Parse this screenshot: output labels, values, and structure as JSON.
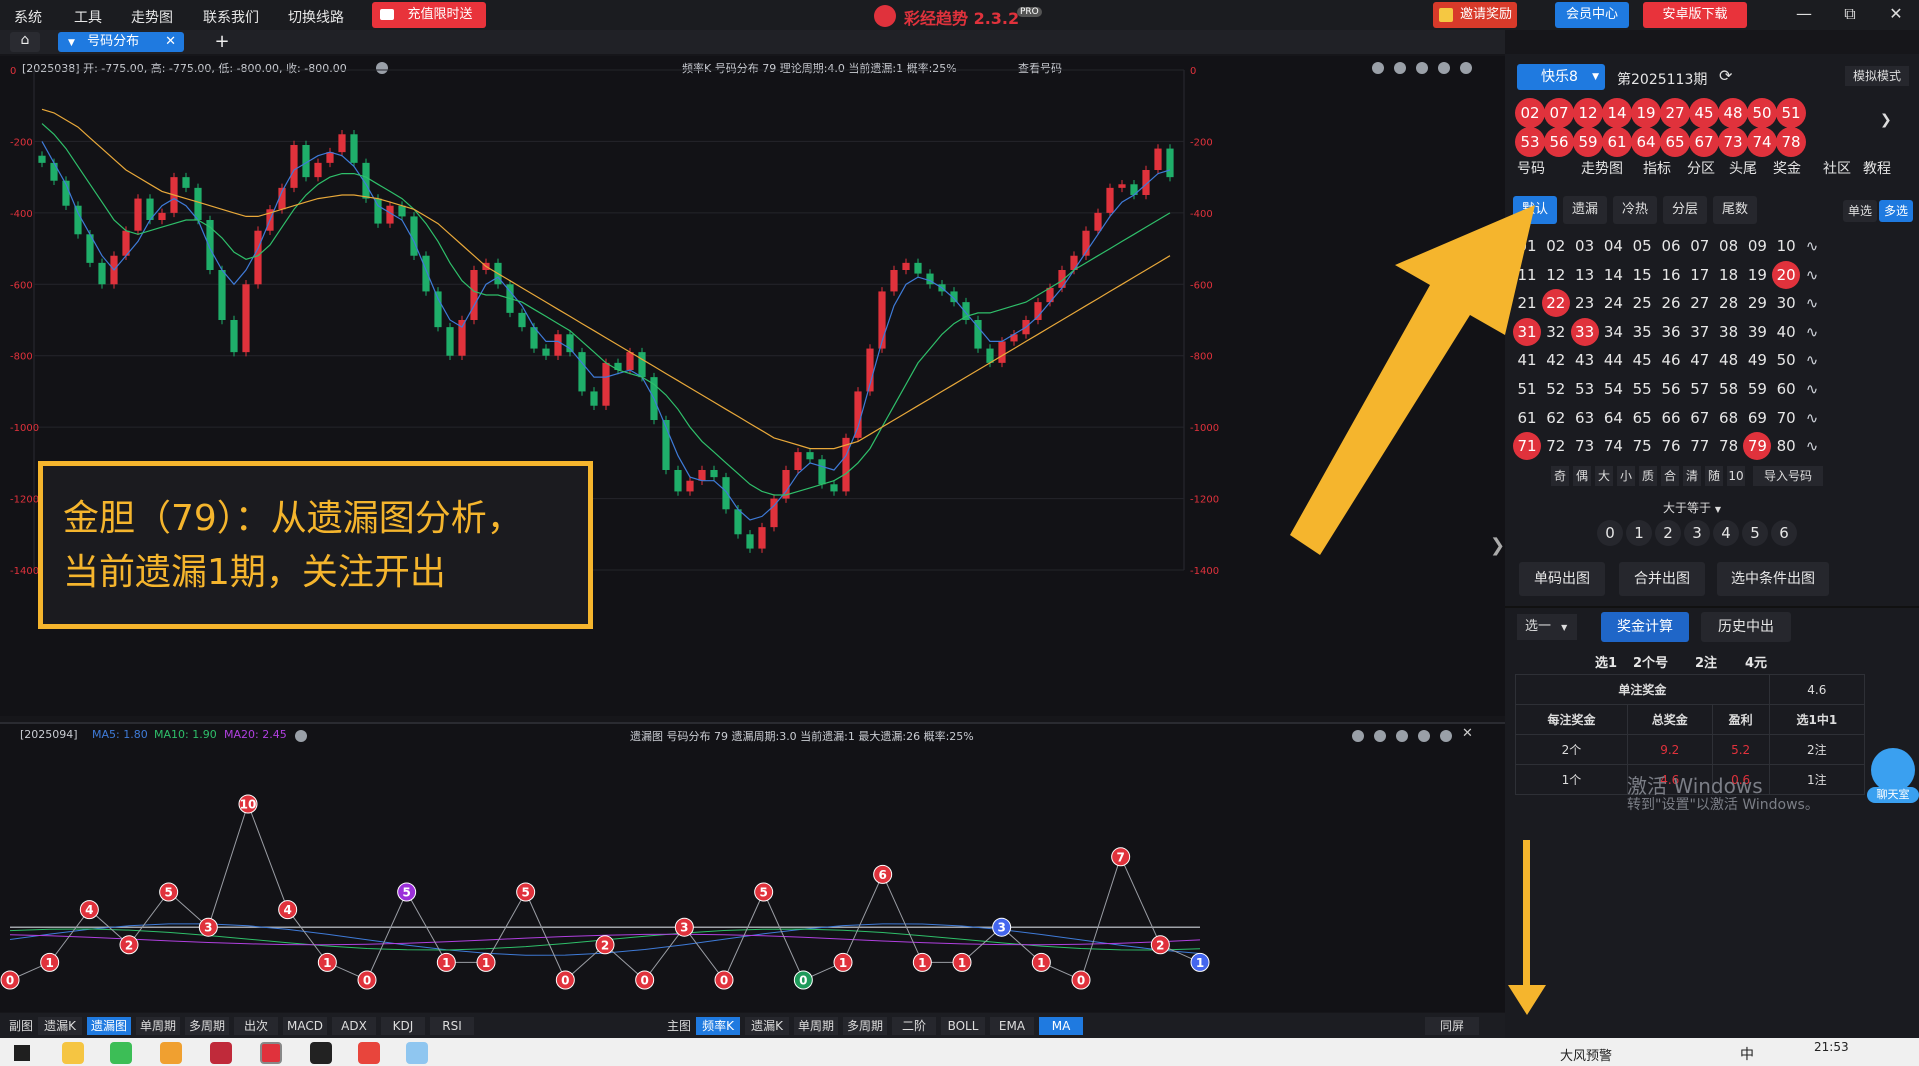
{
  "menu": [
    "系统",
    "工具",
    "走势图",
    "联系我们",
    "切换线路"
  ],
  "promo_label": "充值限时送",
  "app_title": "彩经趋势 2.3.2",
  "app_badge": "PRO",
  "invite_label": "邀请奖励",
  "member_label": "会员中心",
  "android_label": "安卓版下载",
  "tab": {
    "label": "号码分布",
    "add": "+"
  },
  "main_chart": {
    "info_left": "[2025038]   开: -775.00, 高: -775.00, 低: -800.00, 收: -800.00",
    "info_mid": "频率K  号码分布  79    理论周期:4.0  当前遗漏:1  概率:25%",
    "info_link": "查看号码",
    "y_ticks": [
      "0",
      "-200",
      "-400",
      "-600",
      "-800",
      "-1000",
      "-1200",
      "-1400"
    ],
    "ma_colors": [
      "#3f7bd8",
      "#2fbf6a",
      "#e8a83a",
      "#d8d8d8"
    ]
  },
  "chart_data": [
    {
      "type": "candlestick",
      "title": "频率K 号码分布 79",
      "ylim": [
        -1400,
        0
      ],
      "series": [
        {
          "name": "K",
          "values": [
            -260,
            -310,
            -380,
            -460,
            -540,
            -600,
            -520,
            -450,
            -360,
            -420,
            -400,
            -300,
            -330,
            -420,
            -560,
            -700,
            -790,
            -600,
            -450,
            -390,
            -330,
            -210,
            -300,
            -260,
            -230,
            -180,
            -260,
            -360,
            -430,
            -380,
            -410,
            -520,
            -620,
            -720,
            -800,
            -700,
            -560,
            -540,
            -600,
            -680,
            -720,
            -780,
            -800,
            -740,
            -790,
            -900,
            -940,
            -820,
            -840,
            -790,
            -860,
            -980,
            -1120,
            -1180,
            -1150,
            -1120,
            -1140,
            -1230,
            -1300,
            -1340,
            -1280,
            -1200,
            -1120,
            -1070,
            -1090,
            -1160,
            -1180,
            -1030,
            -900,
            -780,
            -620,
            -560,
            -540,
            -570,
            -600,
            -620,
            -650,
            -700,
            -780,
            -820,
            -760,
            -740,
            -700,
            -650,
            -610,
            -560,
            -520,
            -450,
            -400,
            -330,
            -320,
            -350,
            -280,
            -220,
            -300
          ]
        },
        {
          "name": "MA5",
          "values": [
            -200,
            -260,
            -320,
            -400,
            -460,
            -520,
            -560,
            -520,
            -480,
            -420,
            -380,
            -360,
            -380,
            -420,
            -500,
            -560,
            -600,
            -560,
            -500,
            -420,
            -340,
            -280,
            -260,
            -240,
            -230,
            -240,
            -270,
            -320,
            -380,
            -400,
            -420,
            -480,
            -560,
            -640,
            -700,
            -720,
            -660,
            -600,
            -580,
            -620,
            -660,
            -720,
            -760,
            -760,
            -780,
            -820,
            -860,
            -860,
            -850,
            -840,
            -860,
            -920,
            -1000,
            -1080,
            -1140,
            -1150,
            -1150,
            -1180,
            -1230,
            -1260,
            -1250,
            -1220,
            -1180,
            -1130,
            -1100,
            -1110,
            -1120,
            -1080,
            -1000,
            -880,
            -760,
            -660,
            -600,
            -580,
            -590,
            -610,
            -640,
            -680,
            -720,
            -760,
            -760,
            -740,
            -720,
            -690,
            -650,
            -610,
            -560,
            -510,
            -460,
            -410,
            -370,
            -350,
            -320,
            -290,
            -280
          ]
        },
        {
          "name": "MA10",
          "values": [
            -150,
            -180,
            -220,
            -270,
            -320,
            -370,
            -420,
            -450,
            -460,
            -450,
            -440,
            -430,
            -420,
            -420,
            -440,
            -470,
            -510,
            -530,
            -520,
            -490,
            -440,
            -390,
            -350,
            -320,
            -300,
            -290,
            -290,
            -300,
            -320,
            -340,
            -360,
            -390,
            -430,
            -480,
            -540,
            -590,
            -620,
            -630,
            -630,
            -640,
            -650,
            -670,
            -690,
            -710,
            -730,
            -760,
            -790,
            -820,
            -840,
            -850,
            -860,
            -880,
            -910,
            -950,
            -1000,
            -1040,
            -1070,
            -1100,
            -1130,
            -1160,
            -1180,
            -1190,
            -1190,
            -1180,
            -1170,
            -1160,
            -1150,
            -1130,
            -1100,
            -1060,
            -1000,
            -940,
            -880,
            -820,
            -780,
            -740,
            -710,
            -690,
            -680,
            -680,
            -670,
            -660,
            -650,
            -630,
            -610,
            -590,
            -560,
            -540,
            -520,
            -500,
            -480,
            -460,
            -440,
            -420,
            -400
          ]
        },
        {
          "name": "MA20",
          "values": [
            -110,
            -120,
            -140,
            -160,
            -190,
            -220,
            -250,
            -280,
            -300,
            -320,
            -340,
            -350,
            -360,
            -370,
            -380,
            -390,
            -400,
            -410,
            -410,
            -400,
            -390,
            -380,
            -370,
            -360,
            -355,
            -350,
            -350,
            -355,
            -360,
            -370,
            -380,
            -390,
            -410,
            -430,
            -460,
            -490,
            -520,
            -550,
            -570,
            -590,
            -610,
            -630,
            -650,
            -670,
            -690,
            -710,
            -730,
            -750,
            -770,
            -790,
            -810,
            -830,
            -850,
            -870,
            -890,
            -910,
            -930,
            -950,
            -970,
            -990,
            -1010,
            -1030,
            -1040,
            -1050,
            -1060,
            -1060,
            -1060,
            -1050,
            -1040,
            -1020,
            -1000,
            -980,
            -960,
            -940,
            -920,
            -900,
            -880,
            -860,
            -840,
            -820,
            -800,
            -780,
            -760,
            -740,
            -720,
            -700,
            -680,
            -660,
            -640,
            -620,
            -600,
            -580,
            -560,
            -540,
            -520
          ]
        }
      ]
    },
    {
      "type": "line",
      "title": "遗漏图 号码分布 79",
      "ylim": [
        0,
        10
      ],
      "series": [
        {
          "name": "遗漏",
          "values": [
            0,
            1,
            4,
            2,
            5,
            3,
            10,
            4,
            1,
            0,
            5,
            1,
            1,
            5,
            0,
            2,
            0,
            3,
            0,
            5,
            0,
            1,
            6,
            1,
            1,
            3,
            1,
            0,
            7,
            2,
            1
          ]
        }
      ]
    }
  ],
  "annotation": {
    "line1": "金胆（79）：从遗漏图分析，",
    "line2": "当前遗漏1期，关注开出"
  },
  "sub_chart": {
    "info_left": "[2025094]",
    "ma5": "MA5: 1.80",
    "ma10": "MA10: 1.90",
    "ma20": "MA20: 2.45",
    "info_mid": "遗漏图  号码分布  79     遗漏周期:3.0  当前遗漏:1  最大遗漏:26  概率:25%"
  },
  "right": {
    "lottery": "快乐8",
    "period": "第2025113期",
    "sim_mode": "模拟模式",
    "drawn": [
      "02",
      "07",
      "12",
      "14",
      "19",
      "27",
      "45",
      "48",
      "50",
      "51",
      "53",
      "56",
      "59",
      "61",
      "64",
      "65",
      "67",
      "73",
      "74",
      "78"
    ],
    "tabs": [
      "号码",
      "走势图",
      "指标",
      "分区",
      "头尾",
      "奖金",
      "社区",
      "教程"
    ],
    "filters": [
      "默认",
      "遗漏",
      "冷热",
      "分层",
      "尾数"
    ],
    "single": "单选",
    "multi": "多选",
    "grid": [
      "01",
      "02",
      "03",
      "04",
      "05",
      "06",
      "07",
      "08",
      "09",
      "10",
      "11",
      "12",
      "13",
      "14",
      "15",
      "16",
      "17",
      "18",
      "19",
      "20",
      "21",
      "22",
      "23",
      "24",
      "25",
      "26",
      "27",
      "28",
      "29",
      "30",
      "31",
      "32",
      "33",
      "34",
      "35",
      "36",
      "37",
      "38",
      "39",
      "40",
      "41",
      "42",
      "43",
      "44",
      "45",
      "46",
      "47",
      "48",
      "49",
      "50",
      "51",
      "52",
      "53",
      "54",
      "55",
      "56",
      "57",
      "58",
      "59",
      "60",
      "61",
      "62",
      "63",
      "64",
      "65",
      "66",
      "67",
      "68",
      "69",
      "70",
      "71",
      "72",
      "73",
      "74",
      "75",
      "76",
      "77",
      "78",
      "79",
      "80"
    ],
    "selected": [
      "20",
      "22",
      "31",
      "33",
      "71",
      "79"
    ],
    "quick": [
      "奇",
      "偶",
      "大",
      "小",
      "质",
      "合",
      "清",
      "随",
      "10"
    ],
    "import": "导入号码",
    "compare": "大于等于",
    "counts": [
      "0",
      "1",
      "2",
      "3",
      "4",
      "5",
      "6"
    ],
    "actions": [
      "单码出图",
      "合并出图",
      "选中条件出图"
    ],
    "select_type": "选一",
    "calc": "奖金计算",
    "history": "历史中出",
    "summary": [
      "选1",
      "2个号",
      "2注",
      "4元"
    ],
    "single_prize_label": "单注奖金",
    "single_prize": "4.6",
    "table_head": [
      "每注奖金",
      "总奖金",
      "盈利",
      "选1中1"
    ],
    "rows": [
      [
        "2个",
        "9.2",
        "5.2",
        "2注"
      ],
      [
        "1个",
        "4.6",
        "0.6",
        "1注"
      ]
    ],
    "watermark1": "激活 Windows",
    "watermark2": "转到\"设置\"以激活 Windows。",
    "chat": "聊天室"
  },
  "bottom_left": [
    "副图",
    "遗漏K",
    "遗漏图",
    "单周期",
    "多周期",
    "出次",
    "MACD",
    "ADX",
    "KDJ",
    "RSI"
  ],
  "bottom_right": [
    "主图",
    "频率K",
    "遗漏K",
    "单周期",
    "多周期",
    "二阶",
    "BOLL",
    "EMA",
    "MA"
  ],
  "sync": "同屏",
  "taskbar": {
    "weather": "大风预警",
    "ime": "中",
    "time": "21:53"
  }
}
